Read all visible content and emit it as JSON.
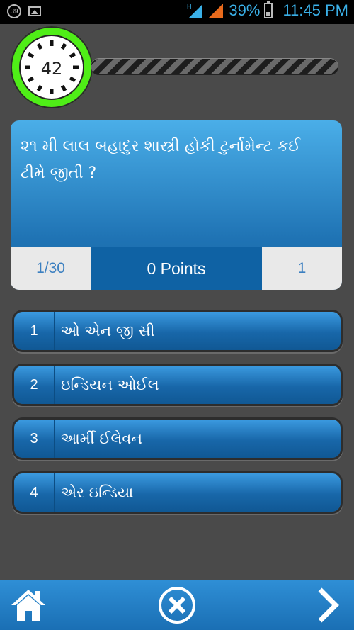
{
  "status_bar": {
    "notification_count": "39",
    "battery_percent": "39%",
    "time": "11:45 PM",
    "icons": [
      "notification-badge-icon",
      "gallery-icon",
      "signal-h-icon",
      "signal-icon",
      "battery-icon"
    ]
  },
  "timer": {
    "seconds_left": "42",
    "ring_color": "#4fee17"
  },
  "progress": {
    "fraction": 0.0
  },
  "question": {
    "text": "૨૧ મી લાલ બહાદુર શાસ્ત્રી હોકી ટુર્નામેન્ટ કઈ ટીમે જીતી ?",
    "counter": "1/30",
    "points": "0 Points",
    "right_value": "1"
  },
  "answers": [
    {
      "number": "1",
      "label": "ઓ એન જી સી"
    },
    {
      "number": "2",
      "label": "ઇન્ડિયન ઓઈલ"
    },
    {
      "number": "3",
      "label": "આર્મી ઈલેવન"
    },
    {
      "number": "4",
      "label": "એર ઇન્ડિયા"
    }
  ],
  "bottom_bar": {
    "buttons": [
      "home-icon",
      "close-circle-icon",
      "chevron-right-icon"
    ]
  },
  "colors": {
    "background": "#4a4a4a",
    "accent_blue": "#1f73b4",
    "status_text": "#3ab0e8"
  }
}
